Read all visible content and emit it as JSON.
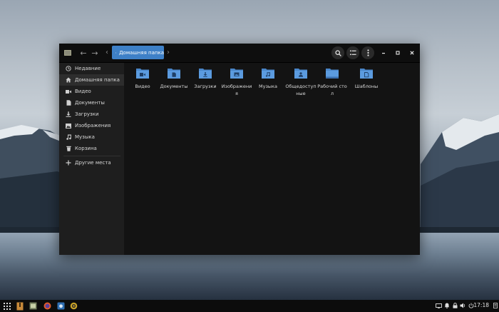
{
  "window": {
    "path_home_label": "Домашняя папка",
    "icons": {
      "app": "file-manager-icon",
      "back": "arrow-left-icon",
      "forward": "arrow-right-icon",
      "search": "search-icon",
      "view": "list-view-icon",
      "menu": "kebab-menu-icon",
      "minimize": "minimize-icon",
      "maximize": "maximize-icon",
      "close": "close-icon"
    }
  },
  "sidebar": {
    "items": [
      {
        "label": "Недавние",
        "icon": "recent-icon"
      },
      {
        "label": "Домашняя папка",
        "icon": "home-icon"
      },
      {
        "label": "Видео",
        "icon": "video-icon"
      },
      {
        "label": "Документы",
        "icon": "document-icon"
      },
      {
        "label": "Загрузки",
        "icon": "download-icon"
      },
      {
        "label": "Изображения",
        "icon": "image-icon"
      },
      {
        "label": "Музыка",
        "icon": "music-icon"
      },
      {
        "label": "Корзина",
        "icon": "trash-icon"
      },
      {
        "label": "Другие места",
        "icon": "plus-icon"
      }
    ]
  },
  "folders": [
    {
      "label": "Видео",
      "icon": "video-folder-icon"
    },
    {
      "label": "Документы",
      "icon": "documents-folder-icon"
    },
    {
      "label": "Загрузки",
      "icon": "downloads-folder-icon"
    },
    {
      "label": "Изображения",
      "icon": "pictures-folder-icon"
    },
    {
      "label": "Музыка",
      "icon": "music-folder-icon"
    },
    {
      "label": "Общедоступные",
      "icon": "public-folder-icon"
    },
    {
      "label": "Рабочий стол",
      "icon": "desktop-folder-icon"
    },
    {
      "label": "Шаблоны",
      "icon": "templates-folder-icon"
    }
  ],
  "taskbar": {
    "clock": "17:18",
    "colors": {
      "accent": "#3e80c7",
      "folder": "#5b9bdf"
    }
  }
}
